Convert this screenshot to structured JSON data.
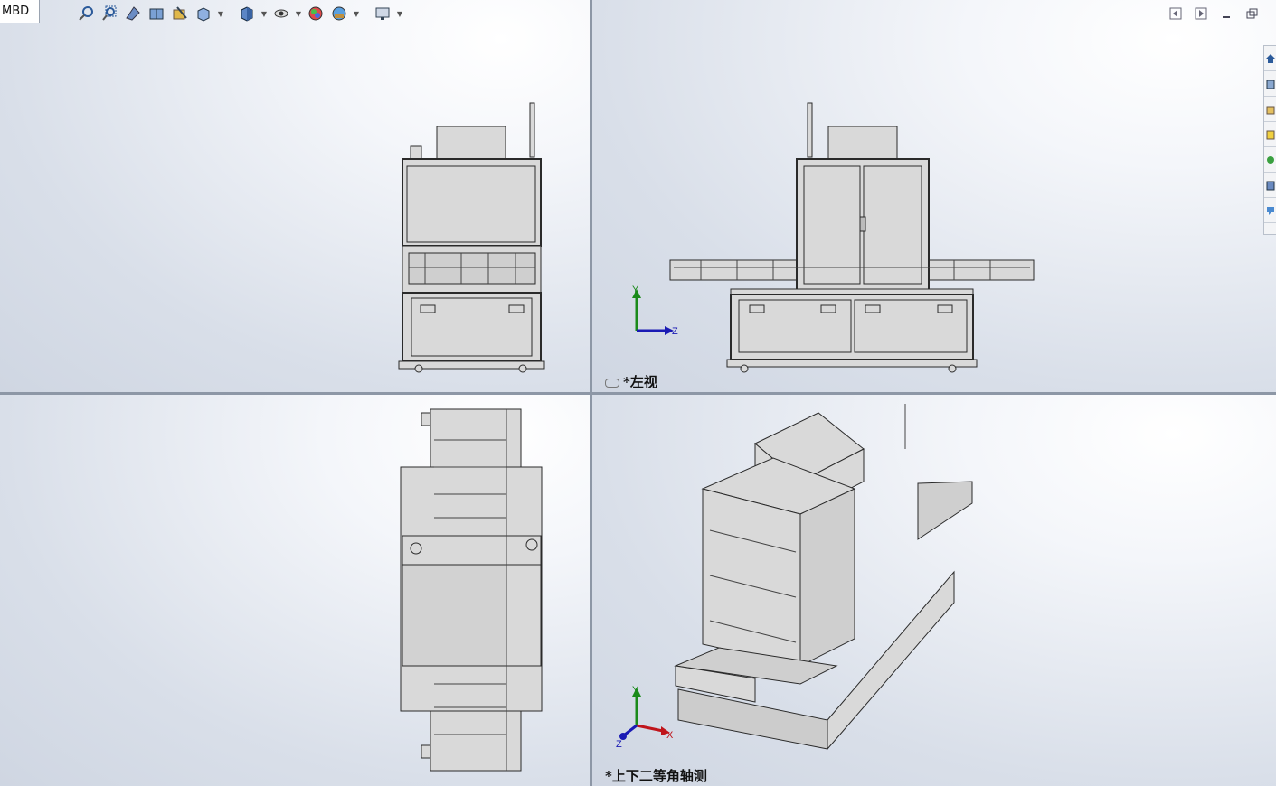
{
  "tab": {
    "label": "MBD"
  },
  "toolbar": {
    "items": [
      "zoom-to-fit-icon",
      "zoom-to-area-icon",
      "previous-view-icon",
      "section-view-icon",
      "dynamic-annotation-icon",
      "view-orientation-icon",
      "display-style-icon",
      "hide-show-items-icon",
      "edit-appearance-icon",
      "apply-scene-icon",
      "view-settings-icon"
    ]
  },
  "views": {
    "top_right": {
      "label": "*左视"
    },
    "bottom_right": {
      "label": "*上下二等角轴测"
    }
  },
  "triad": {
    "y": "Y",
    "z": "Z",
    "x": "X"
  },
  "colors": {
    "background_top": "#ffffff",
    "background_bottom": "#cfd6e2",
    "model_fill": "#d7d7d7",
    "frame_line": "#2a2a2a",
    "axis_x": "#c0141b",
    "axis_y": "#1a8a1a",
    "axis_z": "#1a1ab4",
    "divider": "#8d97a6"
  }
}
